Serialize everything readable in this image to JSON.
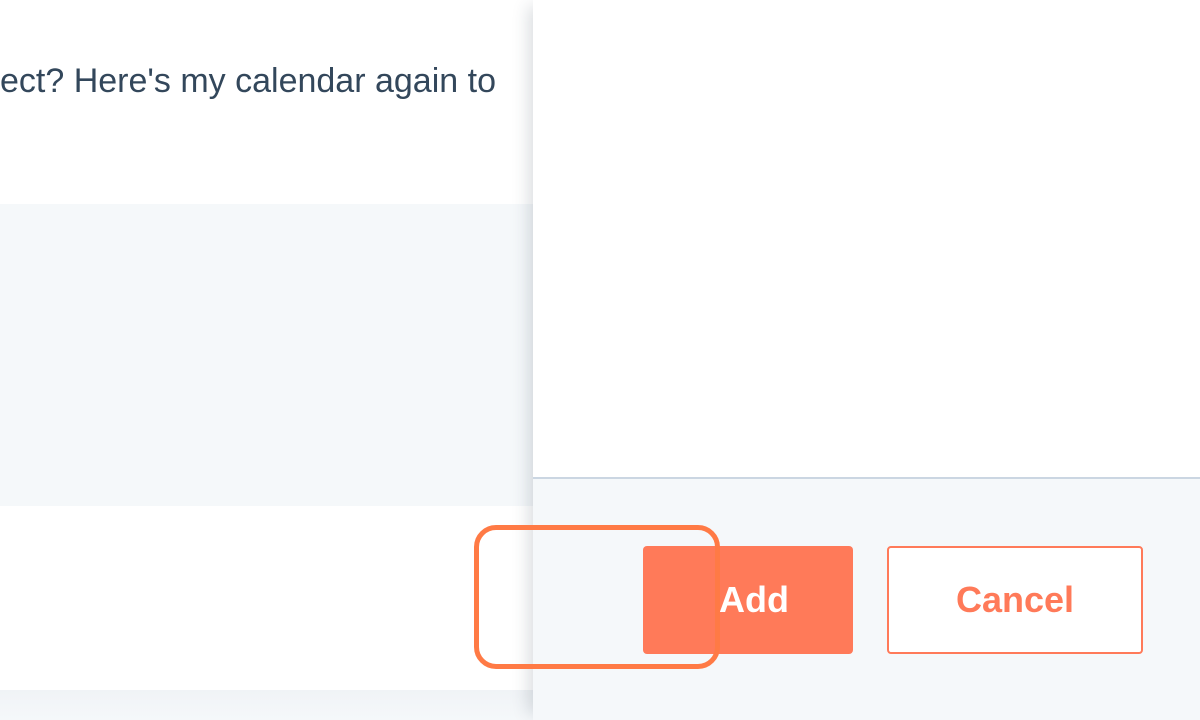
{
  "background": {
    "email_preview_text": "ect? Here's my calendar again to"
  },
  "side_panel": {
    "footer": {
      "add_label": "Add",
      "cancel_label": "Cancel"
    }
  },
  "colors": {
    "accent": "#ff7a59",
    "text": "#33475b",
    "panel_footer_bg": "#f5f8fa",
    "divider": "#cbd6e2"
  }
}
